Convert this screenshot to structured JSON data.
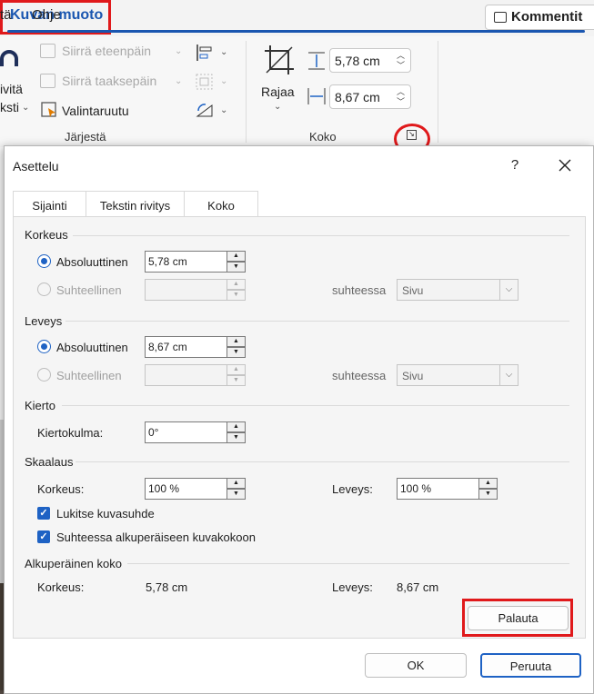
{
  "ribbon": {
    "tabs": [
      {
        "label": "tä"
      },
      {
        "label": "Ohje"
      },
      {
        "label": "Kuvan muoto"
      }
    ],
    "comment_button": "Kommentit",
    "arrange": {
      "left_partial_1": "ivitä",
      "left_partial_2": "ksti",
      "bring_forward": "Siirrä eteenpäin",
      "send_backward": "Siirrä taaksepäin",
      "selection_pane": "Valintaruutu",
      "group_label": "Järjestä"
    },
    "size": {
      "crop_label": "Rajaa",
      "height": "5,78 cm",
      "width": "8,67 cm",
      "group_label": "Koko"
    }
  },
  "dialog": {
    "title": "Asettelu",
    "help": "?",
    "tabs": [
      {
        "label": "Sijainti"
      },
      {
        "label": "Tekstin rivitys"
      },
      {
        "label": "Koko"
      }
    ],
    "height_section": {
      "title": "Korkeus",
      "absolute_label": "Absoluuttinen",
      "absolute_value": "5,78 cm",
      "relative_label": "Suhteellinen",
      "relative_to_label": "suhteessa",
      "relative_to_value": "Sivu"
    },
    "width_section": {
      "title": "Leveys",
      "absolute_label": "Absoluuttinen",
      "absolute_value": "8,67 cm",
      "relative_label": "Suhteellinen",
      "relative_to_label": "suhteessa",
      "relative_to_value": "Sivu"
    },
    "rotation_section": {
      "title": "Kierto",
      "angle_label": "Kiertokulma:",
      "angle_value": "0°"
    },
    "scale_section": {
      "title": "Skaalaus",
      "height_label": "Korkeus:",
      "height_value": "100  %",
      "width_label": "Leveys:",
      "width_value": "100  %",
      "lock_aspect": "Lukitse kuvasuhde",
      "relative_original": "Suhteessa alkuperäiseen kuvakokoon"
    },
    "original_section": {
      "title": "Alkuperäinen koko",
      "height_label": "Korkeus:",
      "height_value": "5,78 cm",
      "width_label": "Leveys:",
      "width_value": "8,67 cm"
    },
    "reset_button": "Palauta",
    "ok_button": "OK",
    "cancel_button": "Peruuta"
  },
  "colors": {
    "accent": "#1e62c4",
    "highlight": "#e0191b",
    "tab_active": "#1a56b0"
  }
}
